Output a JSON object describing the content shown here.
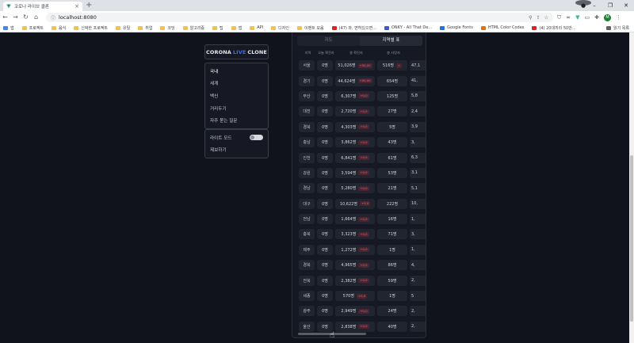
{
  "browser": {
    "tab_title": "코로나 라이브 클론",
    "url": "localhost:8080",
    "window_controls": [
      "–",
      "❐",
      "✕"
    ],
    "bookmarks": [
      {
        "label": "앱",
        "color": "#4285f4"
      },
      {
        "label": "프로젝트",
        "color": "#f2c14e"
      },
      {
        "label": "음식",
        "color": "#f2c14e"
      },
      {
        "label": "신박한 프로젝트",
        "color": "#f2c14e"
      },
      {
        "label": "유틸",
        "color": "#f2c14e"
      },
      {
        "label": "취업",
        "color": "#f2c14e"
      },
      {
        "label": "코딩",
        "color": "#f2c14e"
      },
      {
        "label": "알고리즘",
        "color": "#f2c14e"
      },
      {
        "label": "팁",
        "color": "#f2c14e"
      },
      {
        "label": "앱",
        "color": "#f2c14e"
      },
      {
        "label": "API",
        "color": "#f2c14e"
      },
      {
        "label": "디자인",
        "color": "#f2c14e"
      },
      {
        "label": "이벤트 모음",
        "color": "#f2c14e"
      },
      {
        "label": "(47) 와, 면허있으면...",
        "color": "#e02424"
      },
      {
        "label": "ONKY - All That De...",
        "color": "#3b5bdb"
      },
      {
        "label": "Google Fonts",
        "color": "#1a73e8"
      },
      {
        "label": "HTML Color Codes",
        "color": "#e8710a"
      },
      {
        "label": "(4) 20대끼리 50만...",
        "color": "#e02424"
      }
    ],
    "reading_list": "읽기 목록"
  },
  "sidebar": {
    "logo": {
      "part1": "CORONA",
      "part2": "LIVE",
      "part3": "CLONE"
    },
    "menu": [
      "국내",
      "세계",
      "백신",
      "거리두기",
      "자주 묻는 질문"
    ],
    "menu2": {
      "light_mode": "라이트 모드",
      "report": "제보하기"
    }
  },
  "panel": {
    "tabs": [
      "지도",
      "지역별 표"
    ],
    "headers": [
      "지역",
      "오늘 확진자",
      "총 확진자",
      "총 사망자"
    ]
  },
  "rows": [
    {
      "region": "서울",
      "overseas": "0명",
      "confirmed": "51,026명",
      "badge": "+00,00",
      "deaths": "516명",
      "dbadge": "+",
      "cut": "47,1"
    },
    {
      "region": "경기",
      "overseas": "0명",
      "confirmed": "44,624명",
      "badge": "+00,00",
      "deaths": "654명",
      "dbadge": "",
      "cut": "41,"
    },
    {
      "region": "부산",
      "overseas": "0명",
      "confirmed": "6,307명",
      "badge": "+0,0",
      "deaths": "125명",
      "dbadge": "",
      "cut": "5,8"
    },
    {
      "region": "대전",
      "overseas": "0명",
      "confirmed": "2,720명",
      "badge": "+0,0",
      "deaths": "27명",
      "dbadge": "",
      "cut": "2,4"
    },
    {
      "region": "경북",
      "overseas": "0명",
      "confirmed": "4,303명",
      "badge": "+0,0",
      "deaths": "5명",
      "dbadge": "",
      "cut": "3,9"
    },
    {
      "region": "충남",
      "overseas": "0명",
      "confirmed": "3,862명",
      "badge": "+0,0",
      "deaths": "43명",
      "dbadge": "",
      "cut": "3,"
    },
    {
      "region": "인천",
      "overseas": "0명",
      "confirmed": "6,841명",
      "badge": "+0,0",
      "deaths": "61명",
      "dbadge": "",
      "cut": "6,3"
    },
    {
      "region": "강원",
      "overseas": "0명",
      "confirmed": "3,594명",
      "badge": "+0,0",
      "deaths": "53명",
      "dbadge": "",
      "cut": "3,1"
    },
    {
      "region": "경남",
      "overseas": "0명",
      "confirmed": "5,280명",
      "badge": "+0,0",
      "deaths": "21명",
      "dbadge": "",
      "cut": "5,1"
    },
    {
      "region": "대구",
      "overseas": "0명",
      "confirmed": "10,622명",
      "badge": "+0,0",
      "deaths": "222명",
      "dbadge": "",
      "cut": "10,"
    },
    {
      "region": "전남",
      "overseas": "0명",
      "confirmed": "1,664명",
      "badge": "+0,0",
      "deaths": "16명",
      "dbadge": "",
      "cut": "1,"
    },
    {
      "region": "충북",
      "overseas": "0명",
      "confirmed": "3,323명",
      "badge": "+0,0",
      "deaths": "71명",
      "dbadge": "",
      "cut": "3,"
    },
    {
      "region": "제주",
      "overseas": "0명",
      "confirmed": "1,272명",
      "badge": "+0,0",
      "deaths": "1명",
      "dbadge": "",
      "cut": "1,"
    },
    {
      "region": "경북",
      "overseas": "0명",
      "confirmed": "4,965명",
      "badge": "+0,0",
      "deaths": "86명",
      "dbadge": "",
      "cut": "4,"
    },
    {
      "region": "전북",
      "overseas": "0명",
      "confirmed": "2,382명",
      "badge": "+0,0",
      "deaths": "59명",
      "dbadge": "",
      "cut": "2,"
    },
    {
      "region": "세종",
      "overseas": "0명",
      "confirmed": "570명",
      "badge": "+0,0",
      "deaths": "1명",
      "dbadge": "",
      "cut": "5"
    },
    {
      "region": "광주",
      "overseas": "0명",
      "confirmed": "2,949명",
      "badge": "+0,0",
      "deaths": "24명",
      "dbadge": "",
      "cut": "2,"
    },
    {
      "region": "울산",
      "overseas": "0명",
      "confirmed": "2,838명",
      "badge": "+0,0",
      "deaths": "40명",
      "dbadge": "",
      "cut": "2,"
    }
  ]
}
